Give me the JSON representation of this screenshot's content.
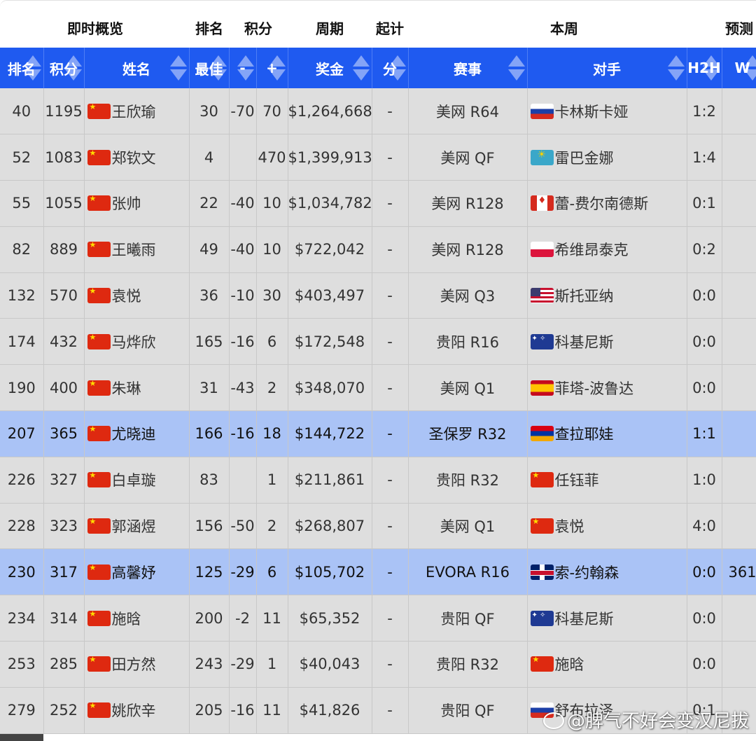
{
  "group_headers": [
    "即时概览",
    "排名",
    "积分",
    "周期",
    "起计",
    "本周",
    "预测"
  ],
  "columns": [
    "排名",
    "积分",
    "姓名",
    "最佳",
    "-",
    "+",
    "奖金",
    "分",
    "赛事",
    "对手",
    "H2H",
    "W"
  ],
  "rows": [
    {
      "rank": "40",
      "pts": "1195",
      "name": "王欣瑜",
      "flag": "cn",
      "best": "30",
      "minus": "-70",
      "plus": "70",
      "prize": "$1,264,668",
      "fen": "-",
      "event": "美网 R64",
      "opp_flag": "ru",
      "opp": "卡林斯卡娅",
      "h2h": "1:2",
      "w": "",
      "hl": false
    },
    {
      "rank": "52",
      "pts": "1083",
      "name": "郑钦文",
      "flag": "cn",
      "best": "4",
      "minus": "",
      "plus": "470",
      "prize": "$1,399,913",
      "fen": "-",
      "event": "美网 QF",
      "opp_flag": "kz",
      "opp": "雷巴金娜",
      "h2h": "1:4",
      "w": "",
      "hl": false
    },
    {
      "rank": "55",
      "pts": "1055",
      "name": "张帅",
      "flag": "cn",
      "best": "22",
      "minus": "-40",
      "plus": "10",
      "prize": "$1,034,782",
      "fen": "-",
      "event": "美网 R128",
      "opp_flag": "ca",
      "opp": "蕾-费尔南德斯",
      "h2h": "0:1",
      "w": "",
      "hl": false
    },
    {
      "rank": "82",
      "pts": "889",
      "name": "王曦雨",
      "flag": "cn",
      "best": "49",
      "minus": "-40",
      "plus": "10",
      "prize": "$722,042",
      "fen": "-",
      "event": "美网 R128",
      "opp_flag": "pl",
      "opp": "希维昂泰克",
      "h2h": "0:2",
      "w": "",
      "hl": false
    },
    {
      "rank": "132",
      "pts": "570",
      "name": "袁悦",
      "flag": "cn",
      "best": "36",
      "minus": "-10",
      "plus": "30",
      "prize": "$403,497",
      "fen": "-",
      "event": "美网 Q3",
      "opp_flag": "us",
      "opp": "斯托亚纳",
      "h2h": "0:0",
      "w": "",
      "hl": false
    },
    {
      "rank": "174",
      "pts": "432",
      "name": "马烨欣",
      "flag": "cn",
      "best": "165",
      "minus": "-16",
      "plus": "6",
      "prize": "$172,548",
      "fen": "-",
      "event": "贵阳 R16",
      "opp_flag": "au",
      "opp": "科基尼斯",
      "h2h": "0:0",
      "w": "",
      "hl": false
    },
    {
      "rank": "190",
      "pts": "400",
      "name": "朱琳",
      "flag": "cn",
      "best": "31",
      "minus": "-43",
      "plus": "2",
      "prize": "$348,070",
      "fen": "-",
      "event": "美网 Q1",
      "opp_flag": "es",
      "opp": "菲塔-波鲁达",
      "h2h": "0:0",
      "w": "",
      "hl": false
    },
    {
      "rank": "207",
      "pts": "365",
      "name": "尤晓迪",
      "flag": "cn",
      "best": "166",
      "minus": "-16",
      "plus": "18",
      "prize": "$144,722",
      "fen": "-",
      "event": "圣保罗 R32",
      "opp_flag": "am",
      "opp": "查拉耶娃",
      "h2h": "1:1",
      "w": "",
      "hl": true
    },
    {
      "rank": "226",
      "pts": "327",
      "name": "白卓璇",
      "flag": "cn",
      "best": "83",
      "minus": "",
      "plus": "1",
      "prize": "$211,861",
      "fen": "-",
      "event": "贵阳 R32",
      "opp_flag": "cn",
      "opp": "任钰菲",
      "h2h": "1:0",
      "w": "",
      "hl": false
    },
    {
      "rank": "228",
      "pts": "323",
      "name": "郭涵煜",
      "flag": "cn",
      "best": "156",
      "minus": "-50",
      "plus": "2",
      "prize": "$268,807",
      "fen": "-",
      "event": "美网 Q1",
      "opp_flag": "cn",
      "opp": "袁悦",
      "h2h": "4:0",
      "w": "",
      "hl": false
    },
    {
      "rank": "230",
      "pts": "317",
      "name": "高馨妤",
      "flag": "cn",
      "best": "125",
      "minus": "-29",
      "plus": "6",
      "prize": "$105,702",
      "fen": "-",
      "event": "EVORA R16",
      "opp_flag": "gb",
      "opp": "索-约翰森",
      "h2h": "0:0",
      "w": "361",
      "hl": true
    },
    {
      "rank": "234",
      "pts": "314",
      "name": "施晗",
      "flag": "cn",
      "best": "200",
      "minus": "-2",
      "plus": "11",
      "prize": "$65,352",
      "fen": "-",
      "event": "贵阳 QF",
      "opp_flag": "au",
      "opp": "科基尼斯",
      "h2h": "0:0",
      "w": "",
      "hl": false
    },
    {
      "rank": "253",
      "pts": "285",
      "name": "田方然",
      "flag": "cn",
      "best": "243",
      "minus": "-29",
      "plus": "1",
      "prize": "$40,043",
      "fen": "-",
      "event": "贵阳 R32",
      "opp_flag": "cn",
      "opp": "施晗",
      "h2h": "0:0",
      "w": "",
      "hl": false
    },
    {
      "rank": "279",
      "pts": "252",
      "name": "姚欣辛",
      "flag": "cn",
      "best": "205",
      "minus": "-16",
      "plus": "11",
      "prize": "$41,826",
      "fen": "-",
      "event": "贵阳 QF",
      "opp_flag": "ru",
      "opp": "舒布拉泽",
      "h2h": "0:1",
      "w": "",
      "hl": false
    }
  ],
  "watermark": "@脾气不好会变汉尼拔"
}
